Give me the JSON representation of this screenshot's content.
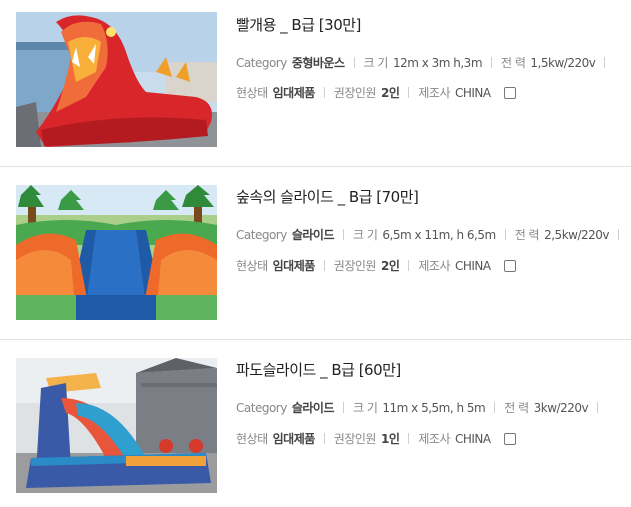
{
  "products": [
    {
      "title": "빨개용 _ B급 [30만]",
      "category_label": "Category",
      "category": "중형바운스",
      "size_label": "크 기",
      "size": "12m x 3m h,3m",
      "power_label": "전 력",
      "power": "1,5kw/220v",
      "status_label": "현상태",
      "status": "임대제품",
      "capacity_label": "권장인원",
      "capacity": "2인",
      "maker_label": "제조사",
      "maker": "CHINA"
    },
    {
      "title": "숲속의 슬라이드 _ B급 [70만]",
      "category_label": "Category",
      "category": "슬라이드",
      "size_label": "크 기",
      "size": "6,5m x 11m, h 6,5m",
      "power_label": "전 력",
      "power": "2,5kw/220v",
      "status_label": "현상태",
      "status": "임대제품",
      "capacity_label": "권장인원",
      "capacity": "2인",
      "maker_label": "제조사",
      "maker": "CHINA"
    },
    {
      "title": "파도슬라이드 _ B급 [60만]",
      "category_label": "Category",
      "category": "슬라이드",
      "size_label": "크 기",
      "size": "11m x 5,5m, h 5m",
      "power_label": "전 력",
      "power": "3kw/220v",
      "status_label": "현상태",
      "status": "임대제품",
      "capacity_label": "권장인원",
      "capacity": "1인",
      "maker_label": "제조사",
      "maker": "CHINA"
    }
  ],
  "colors": {
    "title": "#222222",
    "label": "#888888",
    "value": "#444444",
    "divider": "#e3e3e3"
  }
}
